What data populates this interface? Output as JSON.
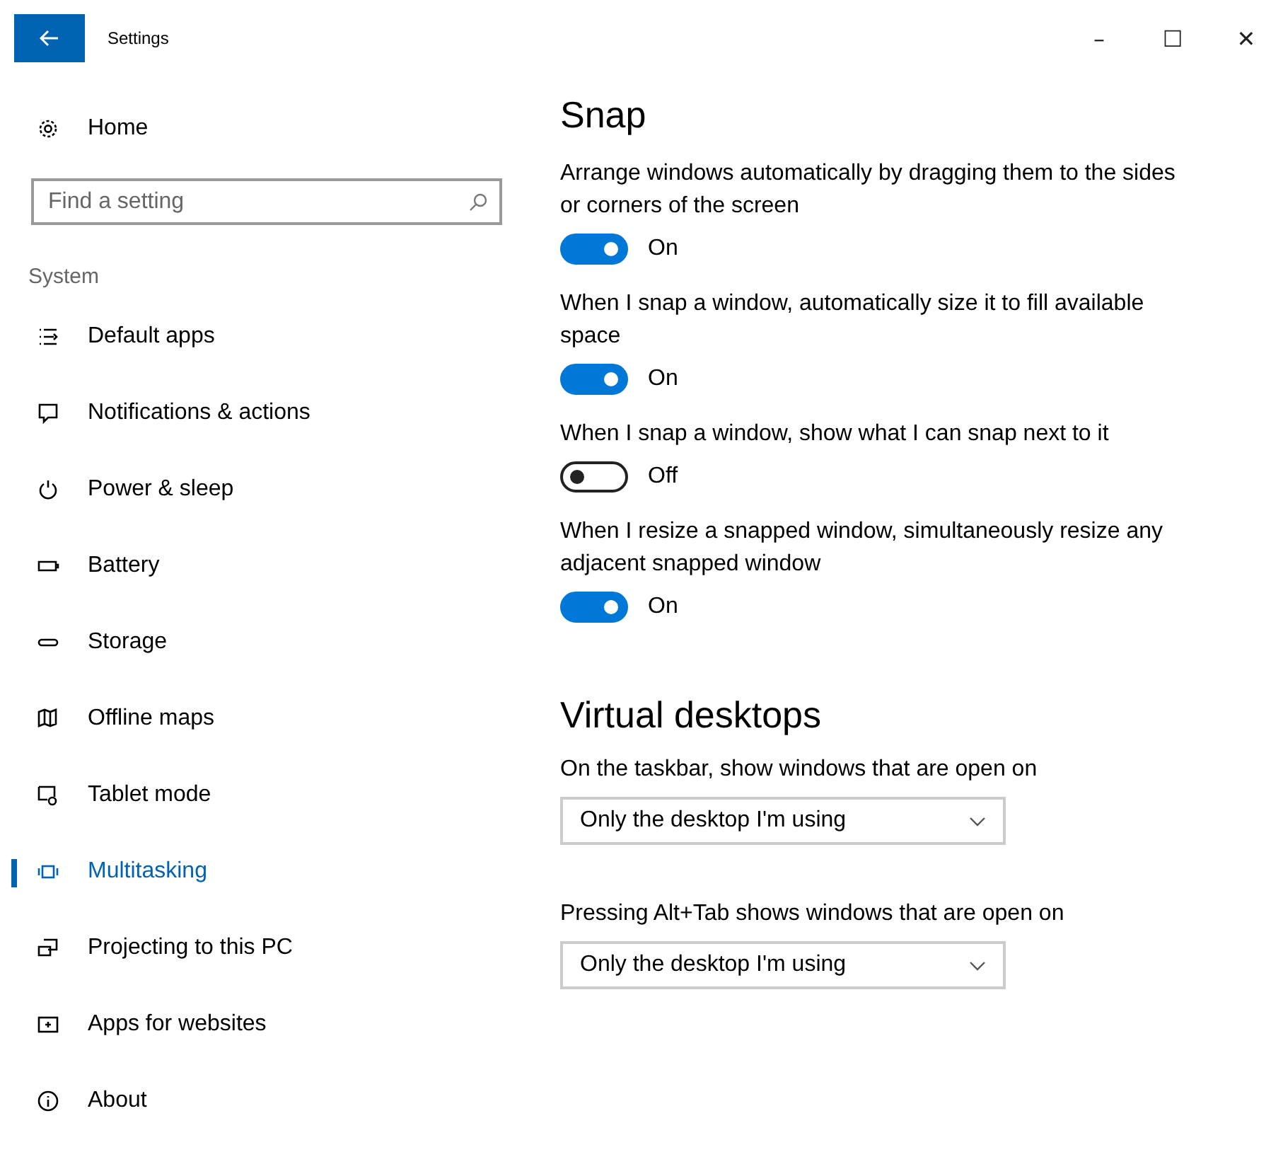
{
  "window": {
    "title": "Settings",
    "controls": [
      "–",
      "☐",
      "✕"
    ]
  },
  "sidebar": {
    "home": "Home",
    "search": {
      "placeholder": "Find a setting"
    },
    "section": "System",
    "items": [
      {
        "label": "Default apps",
        "selected": false
      },
      {
        "label": "Notifications & actions",
        "selected": false
      },
      {
        "label": "Power & sleep",
        "selected": false
      },
      {
        "label": "Battery",
        "selected": false
      },
      {
        "label": "Storage",
        "selected": false
      },
      {
        "label": "Offline maps",
        "selected": false
      },
      {
        "label": "Tablet mode",
        "selected": false
      },
      {
        "label": "Multitasking",
        "selected": true
      },
      {
        "label": "Projecting to this PC",
        "selected": false
      },
      {
        "label": "Apps for websites",
        "selected": false
      },
      {
        "label": "About",
        "selected": false
      }
    ]
  },
  "snap": {
    "heading": "Snap",
    "toggles": [
      {
        "description": "Arrange windows automatically by dragging them to the sides or corners of the screen",
        "on": true,
        "state_label": "On"
      },
      {
        "description": "When I snap a window, automatically size it to fill available space",
        "on": true,
        "state_label": "On"
      },
      {
        "description": "When I snap a window, show what I can snap next to it",
        "on": false,
        "state_label": "Off"
      },
      {
        "description": "When I resize a snapped window, simultaneously resize any adjacent snapped window",
        "on": true,
        "state_label": "On"
      }
    ]
  },
  "virtual_desktops": {
    "heading": "Virtual desktops",
    "dropdowns": [
      {
        "label": "On the taskbar, show windows that are open on",
        "value": "Only the desktop I'm using"
      },
      {
        "label": "Pressing Alt+Tab shows windows that are open on",
        "value": "Only the desktop I'm using"
      }
    ]
  }
}
